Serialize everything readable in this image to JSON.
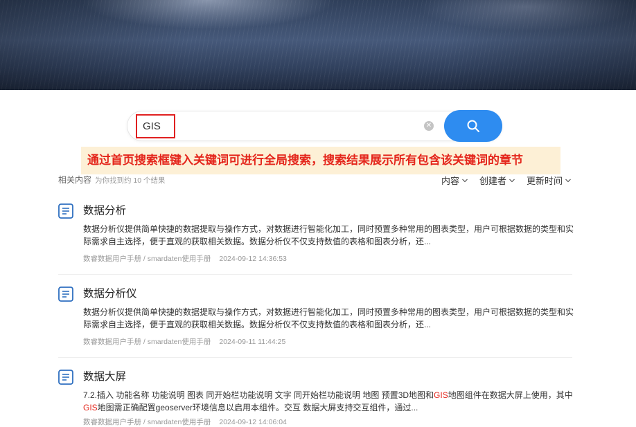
{
  "search": {
    "value": "GIS",
    "clear_icon": "clear-circle-icon",
    "button_icon": "search-icon"
  },
  "notice": "通过首页搜索框键入关键词可进行全局搜索，搜索结果展示所有包含该关键词的章节",
  "summary": {
    "label": "相关内容",
    "count_text": "为你找到约 10 个结果"
  },
  "filters": [
    {
      "label": "内容"
    },
    {
      "label": "创建者"
    },
    {
      "label": "更新时间"
    }
  ],
  "results": [
    {
      "title": "数据分析",
      "snippet_parts": [
        {
          "text": "数据分析仪提供简单快捷的数据提取与操作方式，对数据进行智能化加工，同时预置多种常用的图表类型，用户可根据数据的类型和实际需求自主选择，便于直观的获取相关数据。数据分析仪不仅支持数值的表格和图表分析，还..."
        }
      ],
      "path": "数睿数据用户手册 / smardaten使用手册",
      "time": "2024-09-12 14:36:53"
    },
    {
      "title": "数据分析仪",
      "snippet_parts": [
        {
          "text": "数据分析仪提供简单快捷的数据提取与操作方式，对数据进行智能化加工，同时预置多种常用的图表类型，用户可根据数据的类型和实际需求自主选择，便于直观的获取相关数据。数据分析仪不仅支持数值的表格和图表分析，还..."
        }
      ],
      "path": "数睿数据用户手册 / smardaten使用手册",
      "time": "2024-09-11 11:44:25"
    },
    {
      "title": "数据大屏",
      "snippet_parts": [
        {
          "text": "7.2.插入 功能名称 功能说明 图表 同开始栏功能说明 文字 同开始栏功能说明 地图 预置3D地图和"
        },
        {
          "text": "GIS",
          "hl": true
        },
        {
          "text": "地图组件在数据大屏上使用，其中"
        },
        {
          "text": "GIS",
          "hl": true
        },
        {
          "text": "地图需正确配置geoserver环境信息以启用本组件。交互 数据大屏支持交互组件，通过..."
        }
      ],
      "path": "数睿数据用户手册 / smardaten使用手册",
      "time": "2024-09-12 14:06:04"
    }
  ]
}
